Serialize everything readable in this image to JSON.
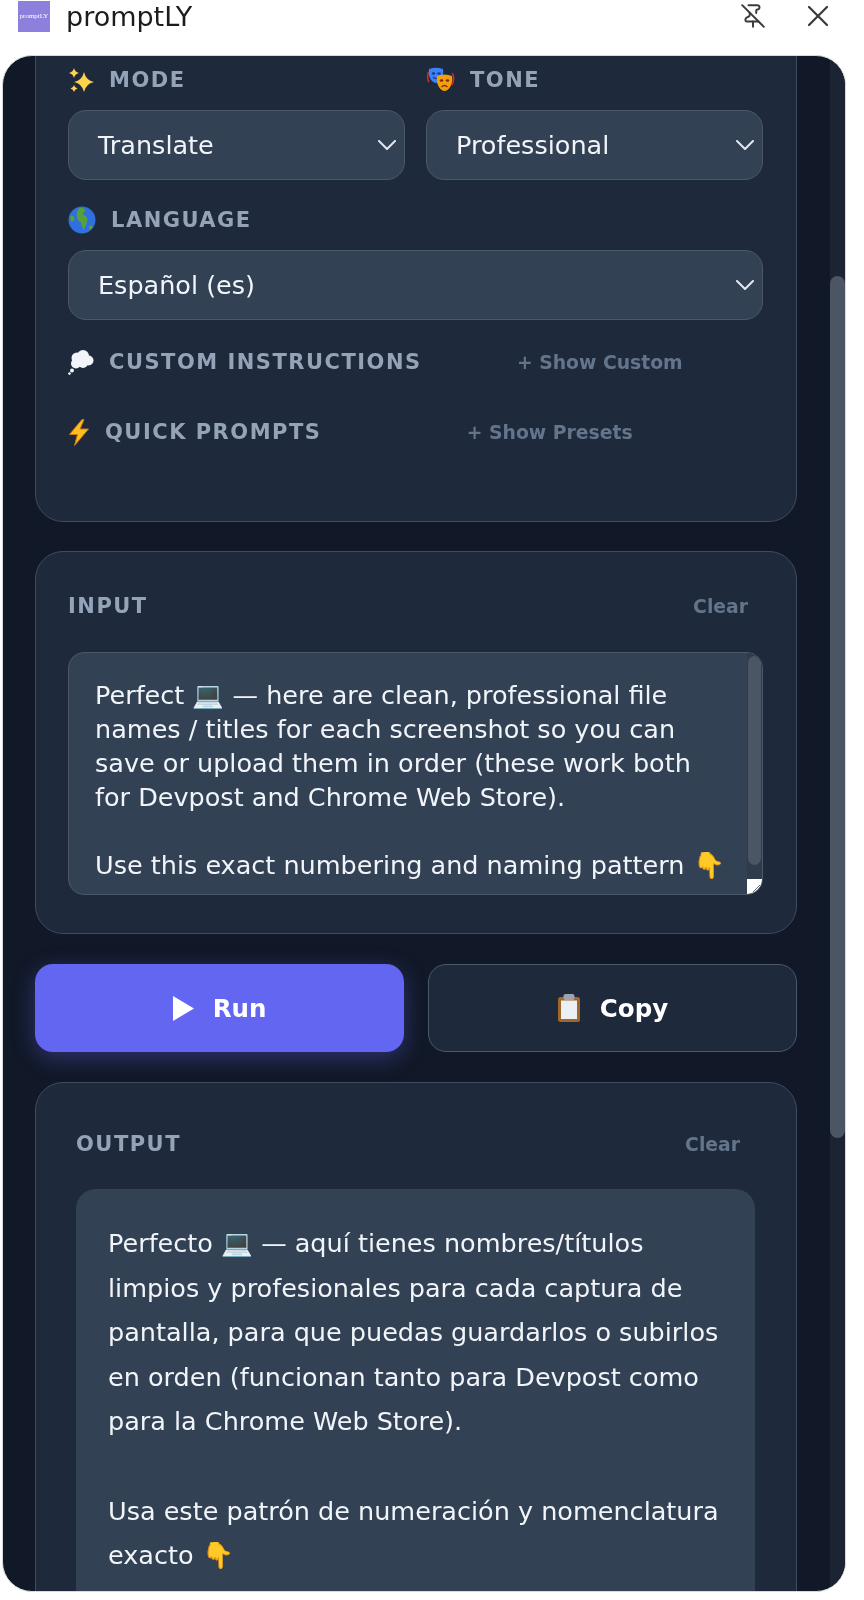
{
  "window": {
    "logo_text": "promptLY",
    "title": "promptLY"
  },
  "settings": {
    "mode": {
      "label": "MODE",
      "value": "Translate"
    },
    "tone": {
      "label": "TONE",
      "value": "Professional"
    },
    "language": {
      "label": "LANGUAGE",
      "value": "Español (es)"
    },
    "custom_instructions": {
      "label": "CUSTOM INSTRUCTIONS",
      "toggle": "+ Show Custom"
    },
    "quick_prompts": {
      "label": "QUICK PROMPTS",
      "toggle": "+ Show Presets"
    }
  },
  "input": {
    "label": "INPUT",
    "clear": "Clear",
    "value": "Perfect 💻 — here are clean, professional file names / titles for each screenshot so you can save or upload them in order (these work both for Devpost and Chrome Web Store).\n\nUse this exact numbering and naming pattern 👇"
  },
  "actions": {
    "run": "Run",
    "copy": "Copy"
  },
  "output": {
    "label": "OUTPUT",
    "clear": "Clear",
    "text": "Perfecto 💻 — aquí tienes nombres/títulos limpios y profesionales para cada captura de pantalla, para que puedas guardarlos o subirlos en orden (funcionan tanto para Devpost como para la Chrome Web Store).\n\nUsa este patrón de numeración y nomenclatura exacto 👇"
  }
}
